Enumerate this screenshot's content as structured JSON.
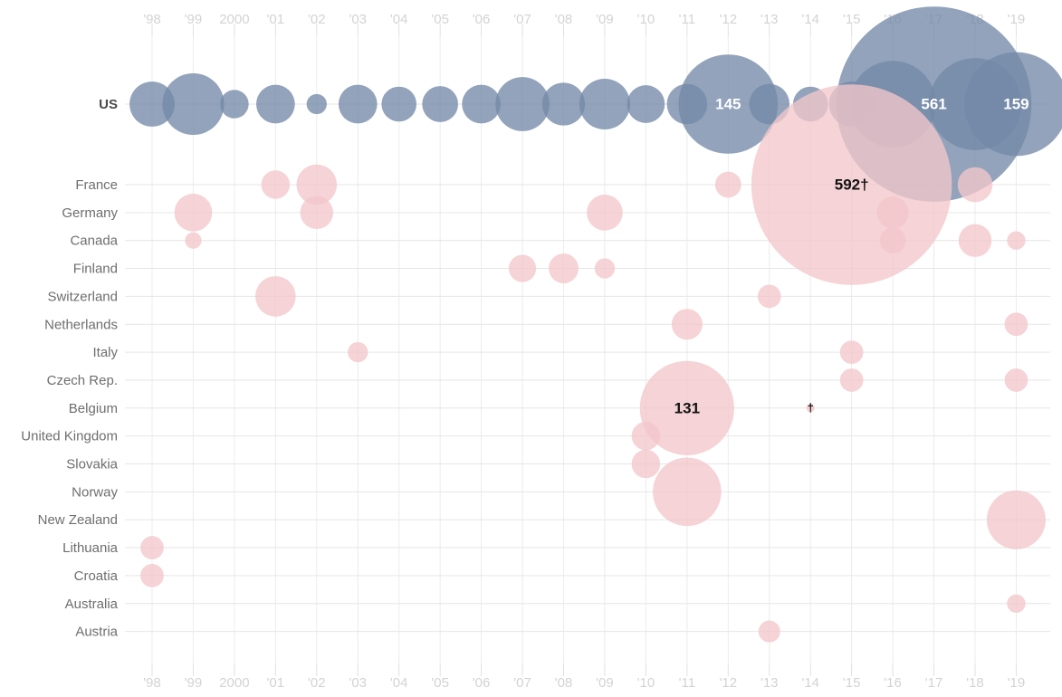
{
  "chart_data": {
    "type": "scatter",
    "title": "",
    "subtitle": "",
    "xlabel": "",
    "ylabel": "",
    "legend_position": "none",
    "grid": true,
    "x_axis": {
      "ticks": [
        "'98",
        "'99",
        "2000",
        "'01",
        "'02",
        "'03",
        "'04",
        "'05",
        "'06",
        "'07",
        "'08",
        "'09",
        "'10",
        "'11",
        "'12",
        "'13",
        "'14",
        "'15",
        "'16",
        "'17",
        "'18",
        "'19"
      ],
      "years": [
        1998,
        1999,
        2000,
        2001,
        2002,
        2003,
        2004,
        2005,
        2006,
        2007,
        2008,
        2009,
        2010,
        2011,
        2012,
        2013,
        2014,
        2015,
        2016,
        2017,
        2018,
        2019
      ],
      "range": [
        1998,
        2019
      ],
      "duplicated_top_and_bottom": true
    },
    "y_axis": {
      "categories": [
        "US",
        "France",
        "Germany",
        "Canada",
        "Finland",
        "Switzerland",
        "Netherlands",
        "Italy",
        "Czech Rep.",
        "Belgium",
        "United Kingdom",
        "Slovakia",
        "Norway",
        "New Zealand",
        "Lithuania",
        "Croatia",
        "Australia",
        "Austria"
      ]
    },
    "colors": {
      "us_bubble": "#7389a8",
      "other_bubble": "#f2c7ca",
      "gridline": "#e9e9e9",
      "xtick_text": "#d3d3d3",
      "ytick_text": "#6e6e6e",
      "us_label_text": "#4a4a4a",
      "light_label": "#ffffff",
      "dark_label": "#111111"
    },
    "annotations": [
      {
        "label": "145",
        "category": "US",
        "year": 2012,
        "style": "light"
      },
      {
        "label": "561",
        "category": "US",
        "year": 2017,
        "style": "light"
      },
      {
        "label": "159",
        "category": "US",
        "year": 2019,
        "style": "light"
      },
      {
        "label": "592†",
        "category": "France",
        "year": 2015,
        "style": "dark"
      },
      {
        "label": "131",
        "category": "Belgium",
        "year": 2011,
        "style": "dark"
      },
      {
        "label": "†",
        "category": "Belgium",
        "year": 2014,
        "style": "dark"
      }
    ],
    "series": [
      {
        "name": "US",
        "color": "#7389a8",
        "points": [
          {
            "year": 1998,
            "value": 30
          },
          {
            "year": 1999,
            "value": 56
          },
          {
            "year": 2000,
            "value": 12
          },
          {
            "year": 2001,
            "value": 22
          },
          {
            "year": 2002,
            "value": 6
          },
          {
            "year": 2003,
            "value": 22
          },
          {
            "year": 2004,
            "value": 18
          },
          {
            "year": 2005,
            "value": 19
          },
          {
            "year": 2006,
            "value": 22
          },
          {
            "year": 2007,
            "value": 43
          },
          {
            "year": 2008,
            "value": 27
          },
          {
            "year": 2009,
            "value": 38
          },
          {
            "year": 2010,
            "value": 21
          },
          {
            "year": 2011,
            "value": 24
          },
          {
            "year": 2012,
            "value": 145
          },
          {
            "year": 2013,
            "value": 24
          },
          {
            "year": 2014,
            "value": 18
          },
          {
            "year": 2015,
            "value": 30
          },
          {
            "year": 2016,
            "value": 110
          },
          {
            "year": 2017,
            "value": 561
          },
          {
            "year": 2018,
            "value": 125
          },
          {
            "year": 2019,
            "value": 159
          }
        ]
      },
      {
        "name": "France",
        "color": "#f2c7ca",
        "points": [
          {
            "year": 2001,
            "value": 12
          },
          {
            "year": 2002,
            "value": 24
          },
          {
            "year": 2012,
            "value": 10
          },
          {
            "year": 2015,
            "value": 592
          },
          {
            "year": 2018,
            "value": 18
          }
        ]
      },
      {
        "name": "Germany",
        "color": "#f2c7ca",
        "points": [
          {
            "year": 1999,
            "value": 21
          },
          {
            "year": 2002,
            "value": 16
          },
          {
            "year": 2009,
            "value": 19
          },
          {
            "year": 2016,
            "value": 15
          }
        ]
      },
      {
        "name": "Canada",
        "color": "#f2c7ca",
        "points": [
          {
            "year": 1999,
            "value": 4
          },
          {
            "year": 2016,
            "value": 10
          },
          {
            "year": 2018,
            "value": 16
          },
          {
            "year": 2019,
            "value": 5
          }
        ]
      },
      {
        "name": "Finland",
        "color": "#f2c7ca",
        "points": [
          {
            "year": 2007,
            "value": 11
          },
          {
            "year": 2008,
            "value": 13
          },
          {
            "year": 2009,
            "value": 6
          }
        ]
      },
      {
        "name": "Switzerland",
        "color": "#f2c7ca",
        "points": [
          {
            "year": 2001,
            "value": 24
          },
          {
            "year": 2013,
            "value": 8
          }
        ]
      },
      {
        "name": "Netherlands",
        "color": "#f2c7ca",
        "points": [
          {
            "year": 2011,
            "value": 14
          },
          {
            "year": 2019,
            "value": 8
          }
        ]
      },
      {
        "name": "Italy",
        "color": "#f2c7ca",
        "points": [
          {
            "year": 2003,
            "value": 6
          },
          {
            "year": 2015,
            "value": 8
          }
        ]
      },
      {
        "name": "Czech Rep.",
        "color": "#f2c7ca",
        "points": [
          {
            "year": 2015,
            "value": 8
          },
          {
            "year": 2019,
            "value": 8
          }
        ]
      },
      {
        "name": "Belgium",
        "color": "#f2c7ca",
        "points": [
          {
            "year": 2011,
            "value": 131
          },
          {
            "year": 2014,
            "value": 1
          }
        ]
      },
      {
        "name": "United Kingdom",
        "color": "#f2c7ca",
        "points": [
          {
            "year": 2010,
            "value": 12
          }
        ]
      },
      {
        "name": "Slovakia",
        "color": "#f2c7ca",
        "points": [
          {
            "year": 2010,
            "value": 12
          }
        ]
      },
      {
        "name": "Norway",
        "color": "#f2c7ca",
        "points": [
          {
            "year": 2011,
            "value": 69
          }
        ]
      },
      {
        "name": "New Zealand",
        "color": "#f2c7ca",
        "points": [
          {
            "year": 2019,
            "value": 51
          }
        ]
      },
      {
        "name": "Lithuania",
        "color": "#f2c7ca",
        "points": [
          {
            "year": 1998,
            "value": 8
          }
        ]
      },
      {
        "name": "Croatia",
        "color": "#f2c7ca",
        "points": [
          {
            "year": 1998,
            "value": 8
          }
        ]
      },
      {
        "name": "Australia",
        "color": "#f2c7ca",
        "points": [
          {
            "year": 2019,
            "value": 5
          }
        ]
      },
      {
        "name": "Austria",
        "color": "#f2c7ca",
        "points": [
          {
            "year": 2013,
            "value": 7
          }
        ]
      }
    ]
  },
  "layout": {
    "x_origin": 168,
    "x_step": 45.45,
    "y_us": 115,
    "y_first_row": 204,
    "y_row_step": 30.85,
    "label_right_edge": 130,
    "radius_scale": 4.55,
    "radius_min": 3.5
  }
}
